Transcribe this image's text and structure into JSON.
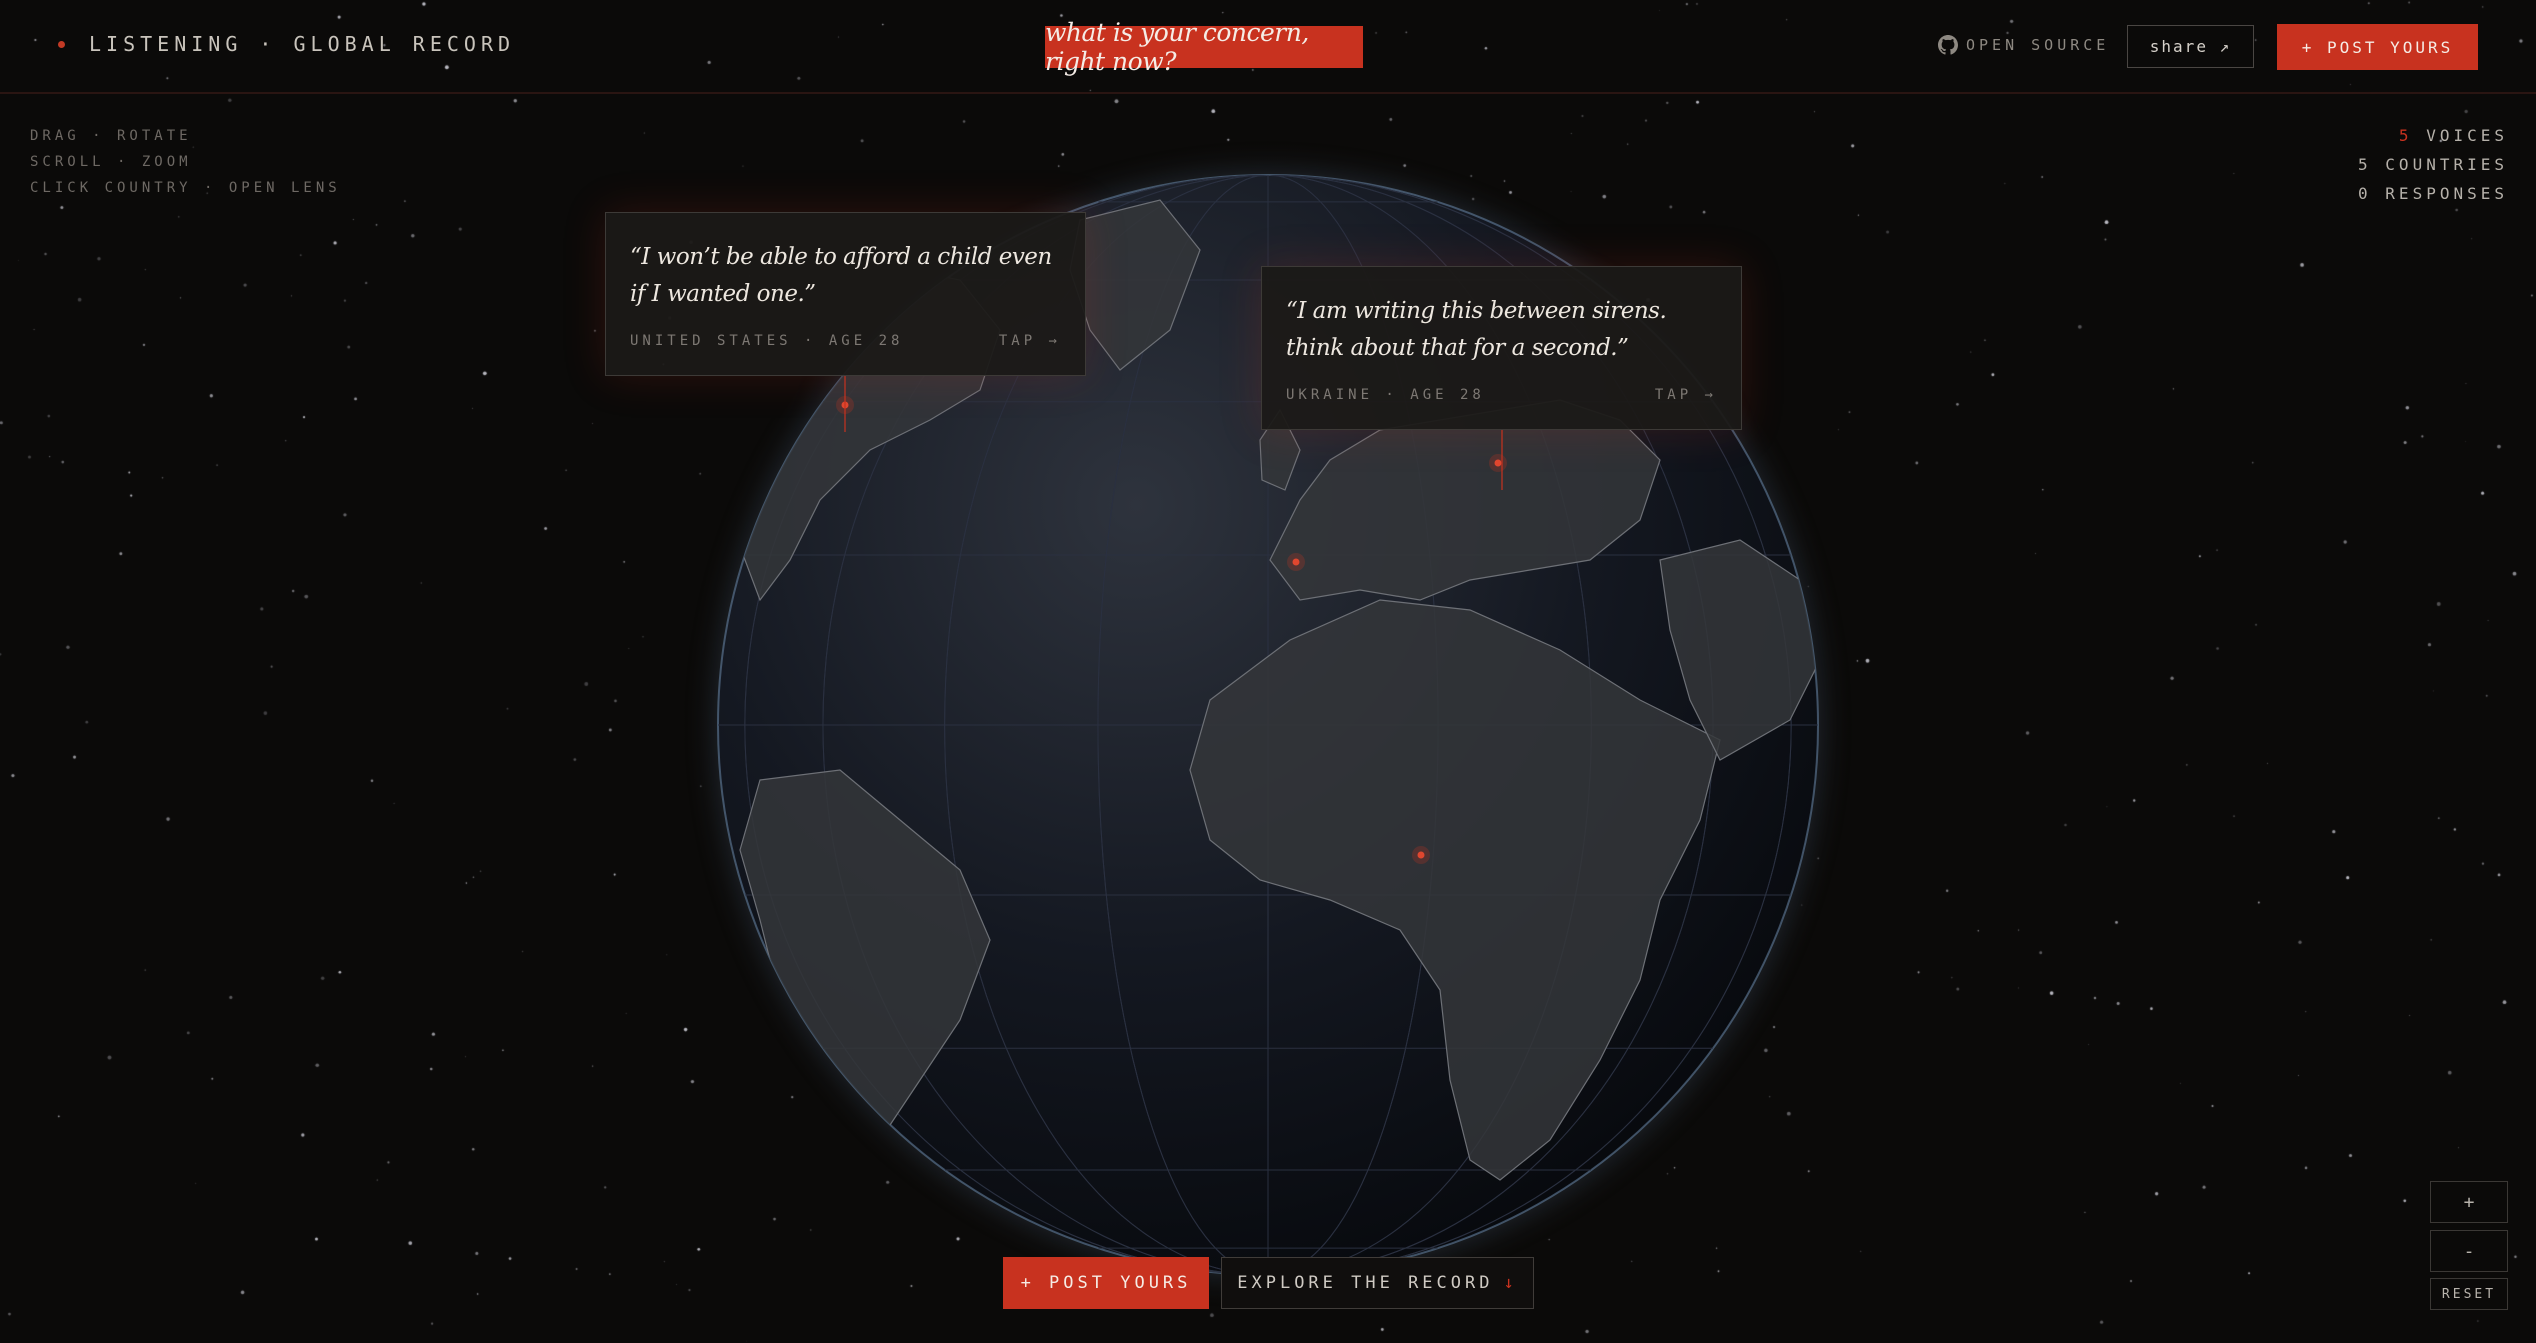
{
  "header": {
    "status": "LISTENING · GLOBAL RECORD",
    "prompt": "what is your concern, right now?",
    "open_source": "OPEN SOURCE",
    "share": "share ↗",
    "post": "+ POST YOURS"
  },
  "hints": [
    "DRAG · ROTATE",
    "SCROLL · ZOOM",
    "CLICK COUNTRY · OPEN LENS"
  ],
  "stats": {
    "voices_count": "5",
    "voices_label": "VOICES",
    "countries": "5 COUNTRIES",
    "responses": "0 RESPONSES"
  },
  "cards": [
    {
      "quote": "“I won’t be able to afford a child even if I wanted one.”",
      "meta": "UNITED STATES · AGE 28",
      "tap": "TAP →"
    },
    {
      "quote": "“I am writing this between sirens. think about that for a second.”",
      "meta": "UKRAINE · AGE 28",
      "tap": "TAP →"
    }
  ],
  "cta": {
    "post": "+ POST YOURS",
    "explore": "EXPLORE THE RECORD",
    "explore_arrow": "↓"
  },
  "zoom": {
    "plus": "+",
    "minus": "-",
    "reset": "RESET"
  },
  "colors": {
    "accent": "#c8321f",
    "background": "#0b0a09"
  },
  "icons": [
    "github-icon"
  ]
}
